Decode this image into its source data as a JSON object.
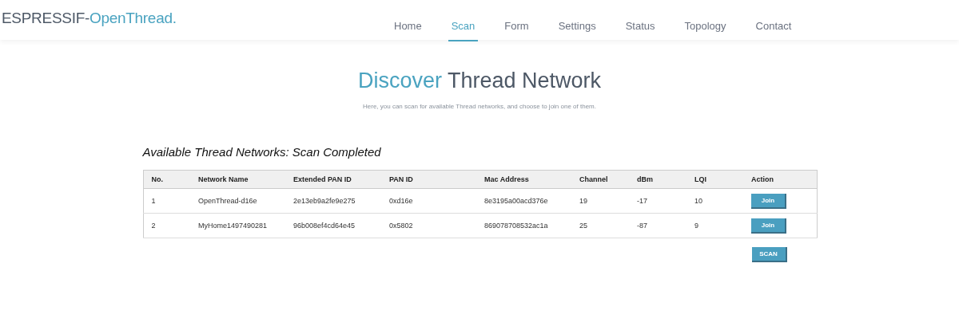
{
  "brand": {
    "prefix": "ESPRESSIF-",
    "name": "OpenThread."
  },
  "nav": [
    {
      "label": "Home",
      "selected": false
    },
    {
      "label": "Scan",
      "selected": true
    },
    {
      "label": "Form",
      "selected": false
    },
    {
      "label": "Settings",
      "selected": false
    },
    {
      "label": "Status",
      "selected": false
    },
    {
      "label": "Topology",
      "selected": false
    },
    {
      "label": "Contact",
      "selected": false
    }
  ],
  "heading": {
    "accent": "Discover",
    "rest": "Thread Network"
  },
  "subtitle": "Here, you can scan for available Thread networks, and choose to join one of them.",
  "section_title": "Available Thread Networks: Scan Completed",
  "table": {
    "columns": [
      "No.",
      "Network Name",
      "Extended PAN ID",
      "PAN ID",
      "Mac Address",
      "Channel",
      "dBm",
      "LQI",
      "Action"
    ],
    "rows": [
      {
        "cells": [
          "1",
          "OpenThread-d16e",
          "2e13eb9a2fe9e275",
          "0xd16e",
          "8e3195a00acd376e",
          "19",
          "-17",
          "10"
        ],
        "action": "Join"
      },
      {
        "cells": [
          "2",
          "MyHome1497490281",
          "96b008ef4cd64e45",
          "0x5802",
          "869078708532ac1a",
          "25",
          "-87",
          "9"
        ],
        "action": "Join"
      }
    ]
  },
  "scan_button": "SCAN"
}
